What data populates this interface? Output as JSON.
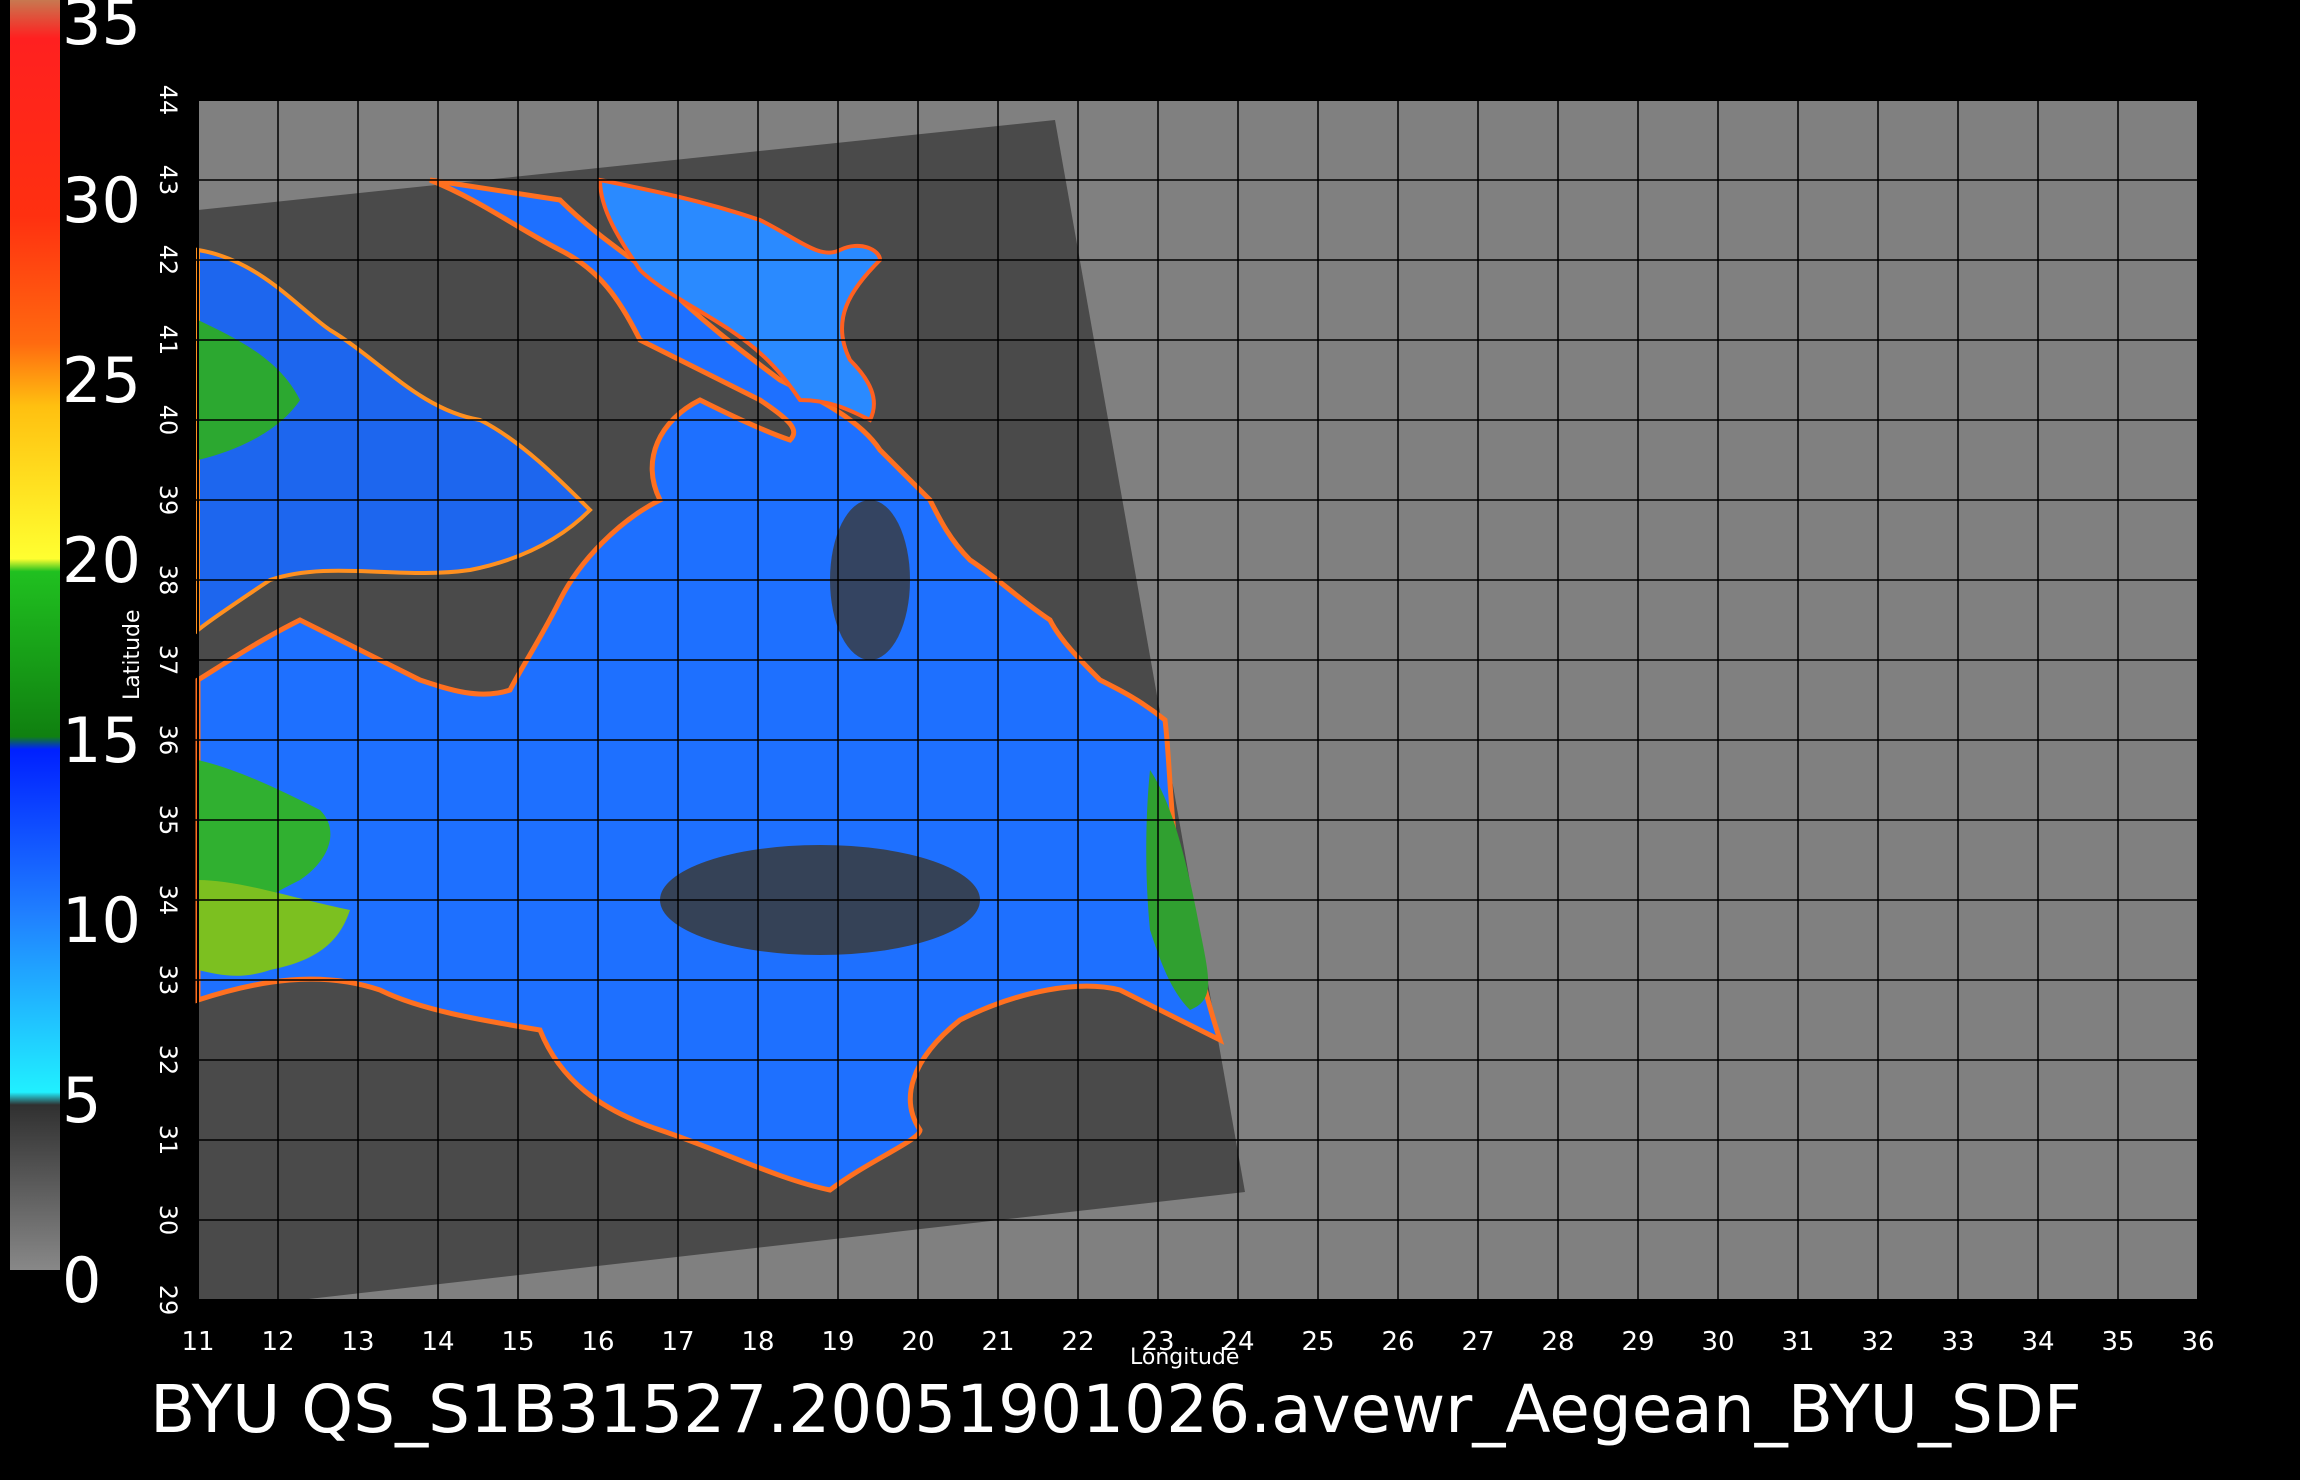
{
  "colorbar": {
    "labels": [
      "35",
      "30",
      "25",
      "20",
      "15",
      "10",
      "5",
      "0"
    ],
    "colors": [
      "#c87850",
      "#ff2020",
      "#ff6010",
      "#ffd020",
      "#20b020",
      "#1040ff",
      "#30a0ff",
      "#40f0ff",
      "#404040",
      "#808080"
    ]
  },
  "map": {
    "x_axis_title": "Longitude",
    "y_axis_title": "Latitude",
    "lon_ticks": [
      "11",
      "12",
      "13",
      "14",
      "15",
      "16",
      "17",
      "18",
      "19",
      "20",
      "21",
      "22",
      "23",
      "24",
      "25",
      "26",
      "27",
      "28",
      "29",
      "30",
      "31",
      "32",
      "33",
      "34",
      "35",
      "36"
    ],
    "lat_ticks": [
      "29",
      "30",
      "31",
      "32",
      "33",
      "34",
      "35",
      "36",
      "37",
      "38",
      "39",
      "40",
      "41",
      "42",
      "43",
      "44"
    ],
    "background_color": "#808080",
    "swath_color": "#4a4a4a",
    "grid_color": "#000000"
  },
  "footer": {
    "title": "BYU  QS_S1B31527.20051901026.avewr_Aegean_BYU_SDF"
  }
}
